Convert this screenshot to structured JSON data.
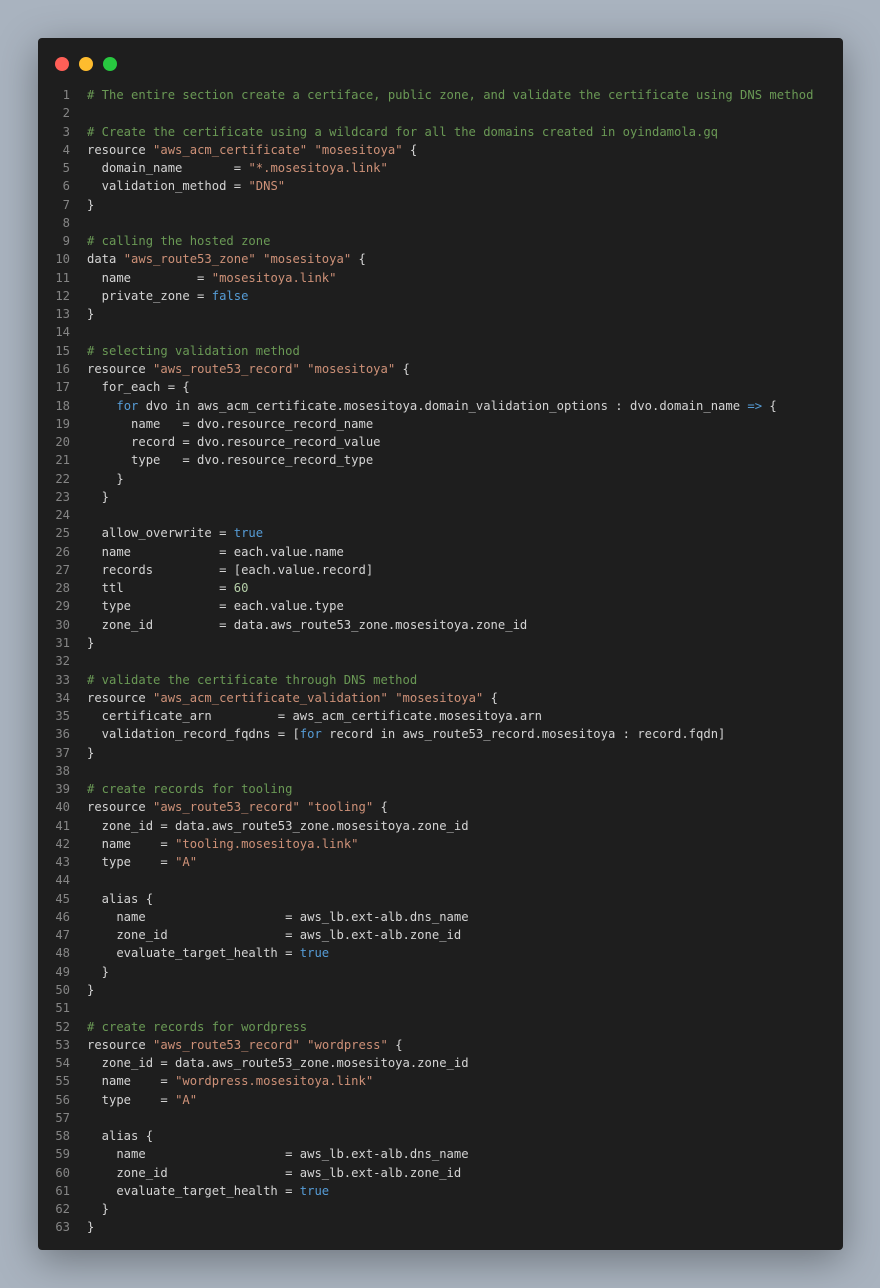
{
  "window": {
    "buttons": [
      "close",
      "minimize",
      "maximize"
    ],
    "colors": {
      "background": "#1e1e1e",
      "comment": "#6a9955",
      "string": "#ce9178",
      "keyword": "#569cd6",
      "number": "#b5cea8",
      "text": "#d4d4d4",
      "line_number": "#858585"
    }
  },
  "code": {
    "language": "hcl",
    "lines": [
      [
        {
          "t": "# The entire section create a certiface, public zone, and validate the certificate using DNS method",
          "c": "c"
        }
      ],
      [],
      [
        {
          "t": "# Create the certificate using a wildcard for all the domains created in oyindamola.gq",
          "c": "c"
        }
      ],
      [
        {
          "t": "resource "
        },
        {
          "t": "\"aws_acm_certificate\"",
          "c": "s"
        },
        {
          "t": " "
        },
        {
          "t": "\"mosesitoya\"",
          "c": "s"
        },
        {
          "t": " {"
        }
      ],
      [
        {
          "t": "  domain_name       = "
        },
        {
          "t": "\"*.mosesitoya.link\"",
          "c": "s"
        }
      ],
      [
        {
          "t": "  validation_method = "
        },
        {
          "t": "\"DNS\"",
          "c": "s"
        }
      ],
      [
        {
          "t": "}"
        }
      ],
      [],
      [
        {
          "t": "# calling the hosted zone",
          "c": "c"
        }
      ],
      [
        {
          "t": "data "
        },
        {
          "t": "\"aws_route53_zone\"",
          "c": "s"
        },
        {
          "t": " "
        },
        {
          "t": "\"mosesitoya\"",
          "c": "s"
        },
        {
          "t": " {"
        }
      ],
      [
        {
          "t": "  name         = "
        },
        {
          "t": "\"mosesitoya.link\"",
          "c": "s"
        }
      ],
      [
        {
          "t": "  private_zone = "
        },
        {
          "t": "false",
          "c": "k"
        }
      ],
      [
        {
          "t": "}"
        }
      ],
      [],
      [
        {
          "t": "# selecting validation method",
          "c": "c"
        }
      ],
      [
        {
          "t": "resource "
        },
        {
          "t": "\"aws_route53_record\"",
          "c": "s"
        },
        {
          "t": " "
        },
        {
          "t": "\"mosesitoya\"",
          "c": "s"
        },
        {
          "t": " {"
        }
      ],
      [
        {
          "t": "  for_each = {"
        }
      ],
      [
        {
          "t": "    "
        },
        {
          "t": "for",
          "c": "k"
        },
        {
          "t": " dvo in aws_acm_certificate.mosesitoya.domain_validation_options : dvo.domain_name "
        },
        {
          "t": "=>",
          "c": "k"
        },
        {
          "t": " {"
        }
      ],
      [
        {
          "t": "      name   = dvo.resource_record_name"
        }
      ],
      [
        {
          "t": "      record = dvo.resource_record_value"
        }
      ],
      [
        {
          "t": "      type   = dvo.resource_record_type"
        }
      ],
      [
        {
          "t": "    }"
        }
      ],
      [
        {
          "t": "  }"
        }
      ],
      [],
      [
        {
          "t": "  allow_overwrite = "
        },
        {
          "t": "true",
          "c": "k"
        }
      ],
      [
        {
          "t": "  name            = each.value.name"
        }
      ],
      [
        {
          "t": "  records         = [each.value.record]"
        }
      ],
      [
        {
          "t": "  ttl             = "
        },
        {
          "t": "60",
          "c": "n"
        }
      ],
      [
        {
          "t": "  type            = each.value.type"
        }
      ],
      [
        {
          "t": "  zone_id         = data.aws_route53_zone.mosesitoya.zone_id"
        }
      ],
      [
        {
          "t": "}"
        }
      ],
      [],
      [
        {
          "t": "# validate the certificate through DNS method",
          "c": "c"
        }
      ],
      [
        {
          "t": "resource "
        },
        {
          "t": "\"aws_acm_certificate_validation\"",
          "c": "s"
        },
        {
          "t": " "
        },
        {
          "t": "\"mosesitoya\"",
          "c": "s"
        },
        {
          "t": " {"
        }
      ],
      [
        {
          "t": "  certificate_arn         = aws_acm_certificate.mosesitoya.arn"
        }
      ],
      [
        {
          "t": "  validation_record_fqdns = ["
        },
        {
          "t": "for",
          "c": "k"
        },
        {
          "t": " record in aws_route53_record.mosesitoya : record.fqdn]"
        }
      ],
      [
        {
          "t": "}"
        }
      ],
      [],
      [
        {
          "t": "# create records for tooling",
          "c": "c"
        }
      ],
      [
        {
          "t": "resource "
        },
        {
          "t": "\"aws_route53_record\"",
          "c": "s"
        },
        {
          "t": " "
        },
        {
          "t": "\"tooling\"",
          "c": "s"
        },
        {
          "t": " {"
        }
      ],
      [
        {
          "t": "  zone_id = data.aws_route53_zone.mosesitoya.zone_id"
        }
      ],
      [
        {
          "t": "  name    = "
        },
        {
          "t": "\"tooling.mosesitoya.link\"",
          "c": "s"
        }
      ],
      [
        {
          "t": "  type    = "
        },
        {
          "t": "\"A\"",
          "c": "s"
        }
      ],
      [],
      [
        {
          "t": "  alias {"
        }
      ],
      [
        {
          "t": "    name                   = aws_lb.ext-alb.dns_name"
        }
      ],
      [
        {
          "t": "    zone_id                = aws_lb.ext-alb.zone_id"
        }
      ],
      [
        {
          "t": "    evaluate_target_health = "
        },
        {
          "t": "true",
          "c": "k"
        }
      ],
      [
        {
          "t": "  }"
        }
      ],
      [
        {
          "t": "}"
        }
      ],
      [],
      [
        {
          "t": "# create records for wordpress",
          "c": "c"
        }
      ],
      [
        {
          "t": "resource "
        },
        {
          "t": "\"aws_route53_record\"",
          "c": "s"
        },
        {
          "t": " "
        },
        {
          "t": "\"wordpress\"",
          "c": "s"
        },
        {
          "t": " {"
        }
      ],
      [
        {
          "t": "  zone_id = data.aws_route53_zone.mosesitoya.zone_id"
        }
      ],
      [
        {
          "t": "  name    = "
        },
        {
          "t": "\"wordpress.mosesitoya.link\"",
          "c": "s"
        }
      ],
      [
        {
          "t": "  type    = "
        },
        {
          "t": "\"A\"",
          "c": "s"
        }
      ],
      [],
      [
        {
          "t": "  alias {"
        }
      ],
      [
        {
          "t": "    name                   = aws_lb.ext-alb.dns_name"
        }
      ],
      [
        {
          "t": "    zone_id                = aws_lb.ext-alb.zone_id"
        }
      ],
      [
        {
          "t": "    evaluate_target_health = "
        },
        {
          "t": "true",
          "c": "k"
        }
      ],
      [
        {
          "t": "  }"
        }
      ],
      [
        {
          "t": "}"
        }
      ]
    ]
  }
}
